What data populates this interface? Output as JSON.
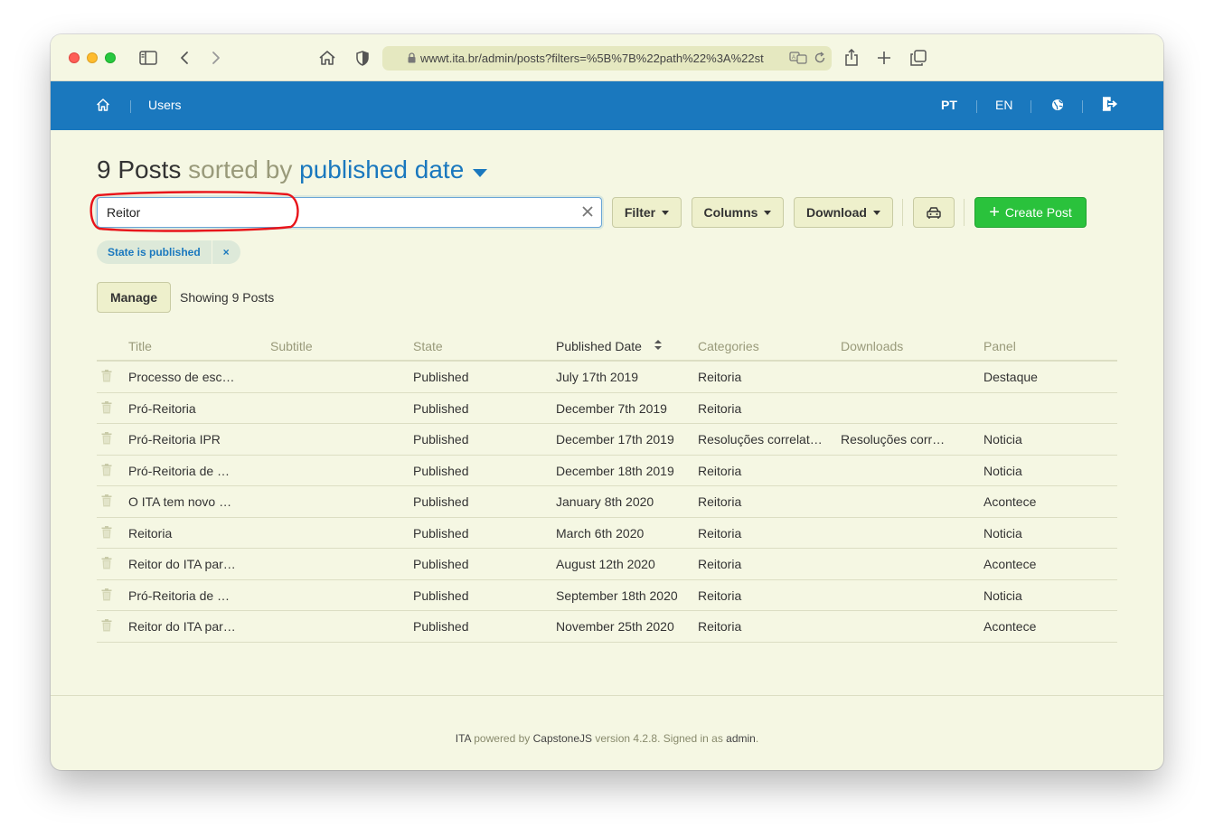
{
  "browser": {
    "url": "wwwt.ita.br/admin/posts?filters=%5B%7B%22path%22%3A%22st"
  },
  "header": {
    "nav_users": "Users",
    "lang_pt": "PT",
    "lang_en": "EN"
  },
  "page": {
    "count": "9 Posts",
    "sorted_by": "sorted by",
    "sort_field": "published date"
  },
  "search": {
    "value": "Reitor"
  },
  "toolbar": {
    "filter_label": "Filter",
    "columns_label": "Columns",
    "download_label": "Download",
    "create_label": "Create Post"
  },
  "active_filter": {
    "label": "State is published",
    "remove": "×"
  },
  "list": {
    "manage_label": "Manage",
    "showing": "Showing 9 Posts"
  },
  "table": {
    "columns": [
      "Title",
      "Subtitle",
      "State",
      "Published Date",
      "Categories",
      "Downloads",
      "Panel"
    ],
    "rows": [
      {
        "title": "Processo de esc…",
        "subtitle": "",
        "state": "Published",
        "date": "July 17th 2019",
        "categories": "Reitoria",
        "downloads": "",
        "panel": "Destaque"
      },
      {
        "title": "Pró-Reitoria",
        "subtitle": "",
        "state": "Published",
        "date": "December 7th 2019",
        "categories": "Reitoria",
        "downloads": "",
        "panel": ""
      },
      {
        "title": "Pró-Reitoria IPR",
        "subtitle": "",
        "state": "Published",
        "date": "December 17th 2019",
        "categories": "Resoluções correlat…",
        "downloads": "Resoluções corr…",
        "panel": "Noticia"
      },
      {
        "title": "Pró-Reitoria de …",
        "subtitle": "",
        "state": "Published",
        "date": "December 18th 2019",
        "categories": "Reitoria",
        "downloads": "",
        "panel": "Noticia"
      },
      {
        "title": "O ITA tem novo …",
        "subtitle": "",
        "state": "Published",
        "date": "January 8th 2020",
        "categories": "Reitoria",
        "downloads": "",
        "panel": "Acontece"
      },
      {
        "title": "Reitoria",
        "subtitle": "",
        "state": "Published",
        "date": "March 6th 2020",
        "categories": "Reitoria",
        "downloads": "",
        "panel": "Noticia"
      },
      {
        "title": "Reitor do ITA par…",
        "subtitle": "",
        "state": "Published",
        "date": "August 12th 2020",
        "categories": "Reitoria",
        "downloads": "",
        "panel": "Acontece"
      },
      {
        "title": "Pró-Reitoria de …",
        "subtitle": "",
        "state": "Published",
        "date": "September 18th 2020",
        "categories": "Reitoria",
        "downloads": "",
        "panel": "Noticia"
      },
      {
        "title": "Reitor do ITA par…",
        "subtitle": "",
        "state": "Published",
        "date": "November 25th 2020",
        "categories": "Reitoria",
        "downloads": "",
        "panel": "Acontece"
      }
    ]
  },
  "footer": {
    "brand": "ITA",
    "powered_by": "powered by",
    "framework": "CapstoneJS",
    "version_prefix": "version",
    "version": "4.2.8",
    "signed_in_prefix": "Signed in as",
    "user": "admin"
  },
  "colors": {
    "header_blue": "#1a78be",
    "page_bg": "#f5f7e3",
    "create_green": "#2ac23c",
    "highlight_red": "#e8141a"
  },
  "icons": [
    "home-icon",
    "sidebar-icon",
    "back-icon",
    "forward-icon",
    "shield-icon",
    "lock-icon",
    "translate-icon",
    "reload-icon",
    "share-icon",
    "new-tab-icon",
    "tabs-icon",
    "globe-icon",
    "sign-out-icon",
    "trash-icon",
    "sort-icon",
    "clear-icon",
    "car-icon"
  ]
}
